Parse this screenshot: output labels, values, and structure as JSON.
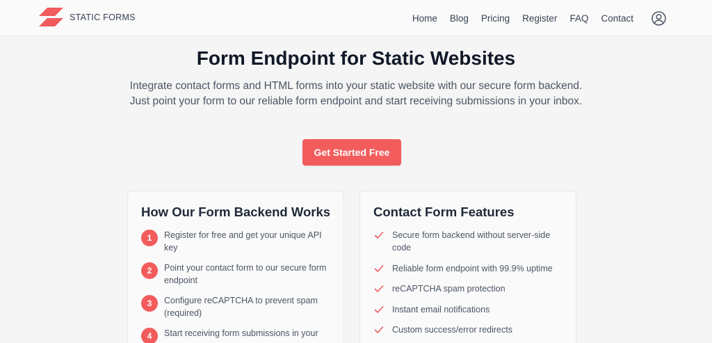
{
  "brand": {
    "name": "STATIC FORMS",
    "accent": "#f25c5c"
  },
  "nav": {
    "links": [
      "Home",
      "Blog",
      "Pricing",
      "Register",
      "FAQ",
      "Contact"
    ],
    "user_icon": "user-circle-icon"
  },
  "hero": {
    "title": "Form Endpoint for Static Websites",
    "subtitle": "Integrate contact forms and HTML forms into your static website with our secure form backend. Just point your form to our reliable form endpoint and start receiving submissions in your inbox.",
    "cta": "Get Started Free"
  },
  "how_it_works": {
    "title": "How Our Form Backend Works",
    "steps": [
      {
        "num": "1",
        "text": "Register for free and get your unique API key"
      },
      {
        "num": "2",
        "text": "Point your contact form to our secure form endpoint"
      },
      {
        "num": "3",
        "text": "Configure reCAPTCHA to prevent spam (required)"
      },
      {
        "num": "4",
        "text": "Start receiving form submissions in your"
      }
    ]
  },
  "features": {
    "title": "Contact Form Features",
    "check_icon": "check-icon",
    "items": [
      "Secure form backend without server-side code",
      "Reliable form endpoint with 99.9% uptime",
      "reCAPTCHA spam protection",
      "Instant email notifications",
      "Custom success/error redirects"
    ]
  }
}
